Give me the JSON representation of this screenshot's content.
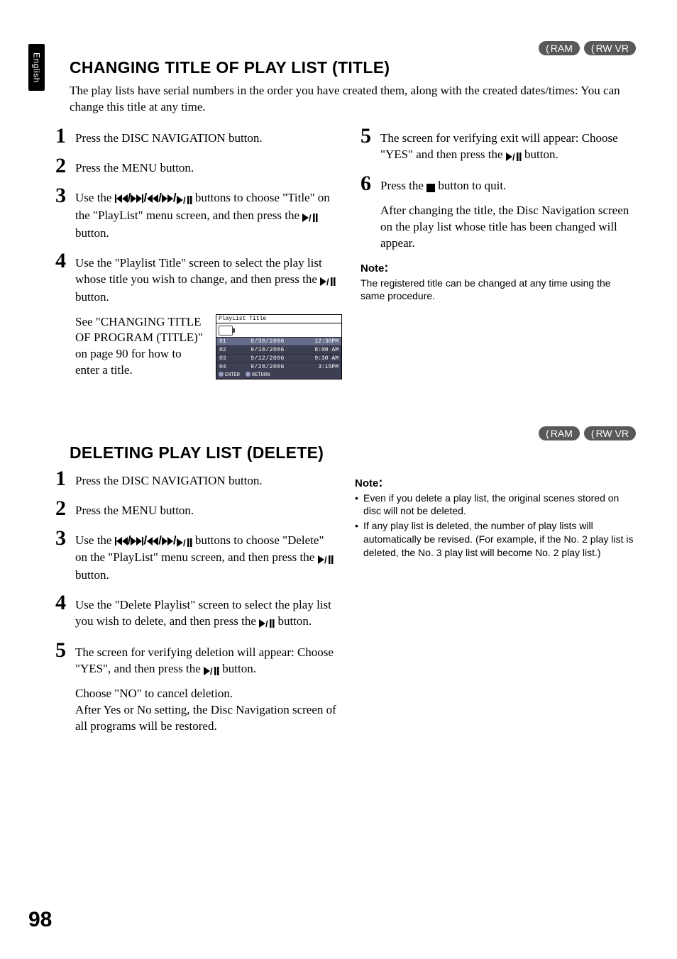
{
  "side_tab": "English",
  "badges": {
    "ram": "RAM",
    "rwvr": "RW VR"
  },
  "section1": {
    "title": "CHANGING TITLE OF PLAY LIST (TITLE)",
    "intro": "The play lists have serial numbers in the order you have created them, along with the created dates/times: You can change this title at any time.",
    "steps_left": {
      "s1": "Press the DISC NAVIGATION button.",
      "s2": "Press the MENU button.",
      "s3a": "Use the ",
      "s3b": " buttons to choose \"Title\" on the \"PlayList\" menu screen, and then press the ",
      "s3c": " button.",
      "s4a": "Use the \"Playlist Title\" screen to select the play list whose title you wish to change, and then press the ",
      "s4b": " button.",
      "see": "See \"CHANGING TITLE OF PROGRAM (TITLE)\" on page 90 for how to enter a title."
    },
    "steps_right": {
      "s5a": "The screen for verifying exit will appear: Choose \"YES\" and then press the ",
      "s5b": " button.",
      "s6a": "Press the ",
      "s6b": " button to quit.",
      "after": "After changing the title, the Disc Navigation screen on the play list whose title has been changed will appear."
    },
    "note_head": "Note",
    "note_body": "The registered title can be changed at any time using the same procedure.",
    "ui": {
      "title": "PlayList Title",
      "rows": [
        {
          "no": "01",
          "date": "8/30/2006",
          "time": "12:30PM"
        },
        {
          "no": "02",
          "date": "9/10/2006",
          "time": "8:00 AM"
        },
        {
          "no": "03",
          "date": "9/12/2006",
          "time": "9:30 AM"
        },
        {
          "no": "04",
          "date": "9/20/2006",
          "time": "3:15PM"
        }
      ],
      "footer_enter": "ENTER",
      "footer_return": "RETURN"
    }
  },
  "section2": {
    "title": "DELETING PLAY LIST (DELETE)",
    "steps": {
      "s1": "Press the DISC NAVIGATION button.",
      "s2": "Press the MENU button.",
      "s3a": "Use the ",
      "s3b": " buttons to choose \"Delete\" on the \"PlayList\" menu screen, and then press the ",
      "s3c": " button.",
      "s4a": "Use the \"Delete Playlist\" screen to select the play list you wish to delete, and then press the ",
      "s4b": " button.",
      "s5a": "The screen for verifying deletion will appear: Choose \"YES\", and then press the ",
      "s5b": " button.",
      "s5extra1": "Choose \"NO\" to cancel deletion.",
      "s5extra2": "After Yes or No setting, the Disc Navigation screen of all programs will be restored."
    },
    "note_head": "Note",
    "notes": [
      "Even if you delete a play list, the original scenes stored on disc will not be deleted.",
      "If any play list is deleted, the number of play lists will automatically be revised. (For example, if the No. 2 play list is deleted, the No. 3 play list will become No. 2 play list.)"
    ]
  },
  "page_number": "98"
}
